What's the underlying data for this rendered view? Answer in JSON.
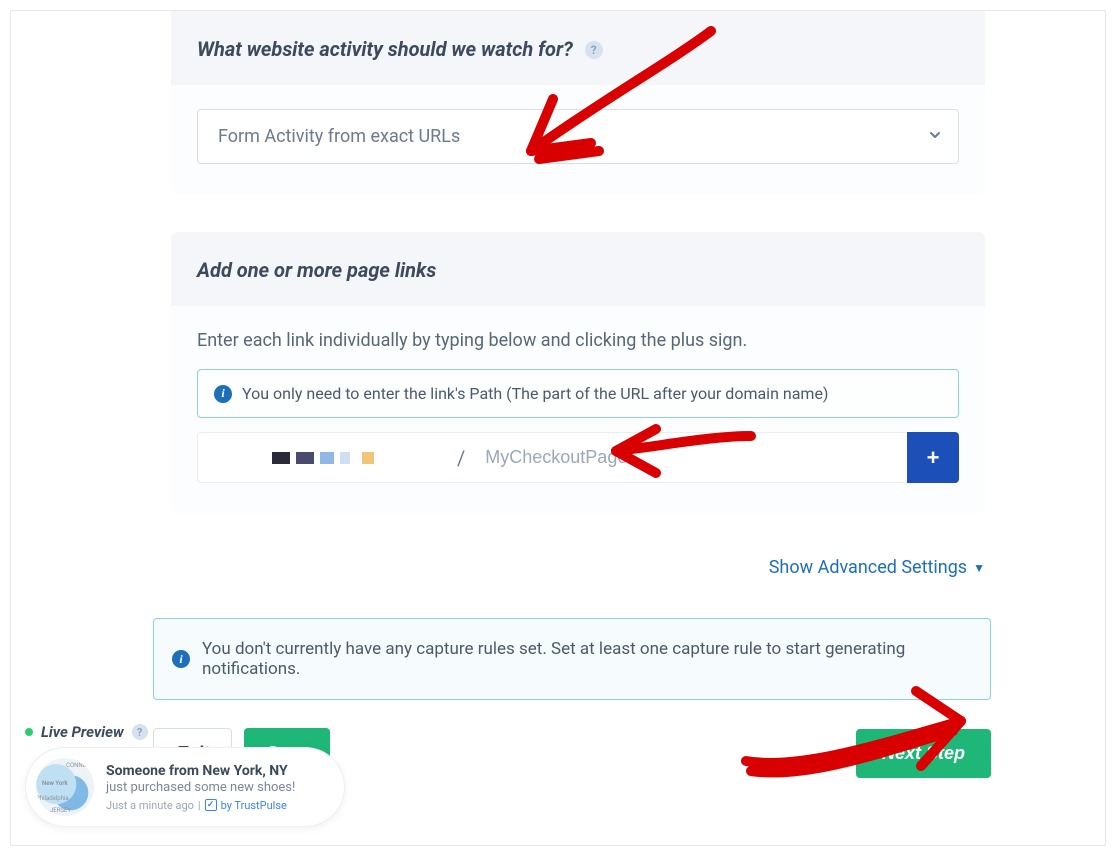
{
  "section1": {
    "heading": "What website activity should we watch for?",
    "select_value": "Form Activity from exact URLs"
  },
  "section2": {
    "heading": "Add one or more page links",
    "instruction": "Enter each link individually by typing below and clicking the plus sign.",
    "info_text": "You only need to enter the link's Path (The part of the URL after your domain name)",
    "slash": "/",
    "placeholder": "MyCheckoutPage",
    "add_label": "+"
  },
  "advanced_link": "Show Advanced Settings",
  "warn_text": "You don't currently have any capture rules set. Set at least one capture rule to start generating notifications.",
  "buttons": {
    "exit": "Exit",
    "save": "Save",
    "next": "Next Step"
  },
  "live_preview": {
    "label": "Live Preview",
    "toast_title": "Someone from New York, NY",
    "toast_sub": "just purchased some new shoes!",
    "toast_time": "Just a minute ago",
    "by_text": "by TrustPulse",
    "map_labels": {
      "top": "CONNEC",
      "mid": "New York",
      "left": "Philadelphia",
      "bot": "JERSEY"
    }
  }
}
